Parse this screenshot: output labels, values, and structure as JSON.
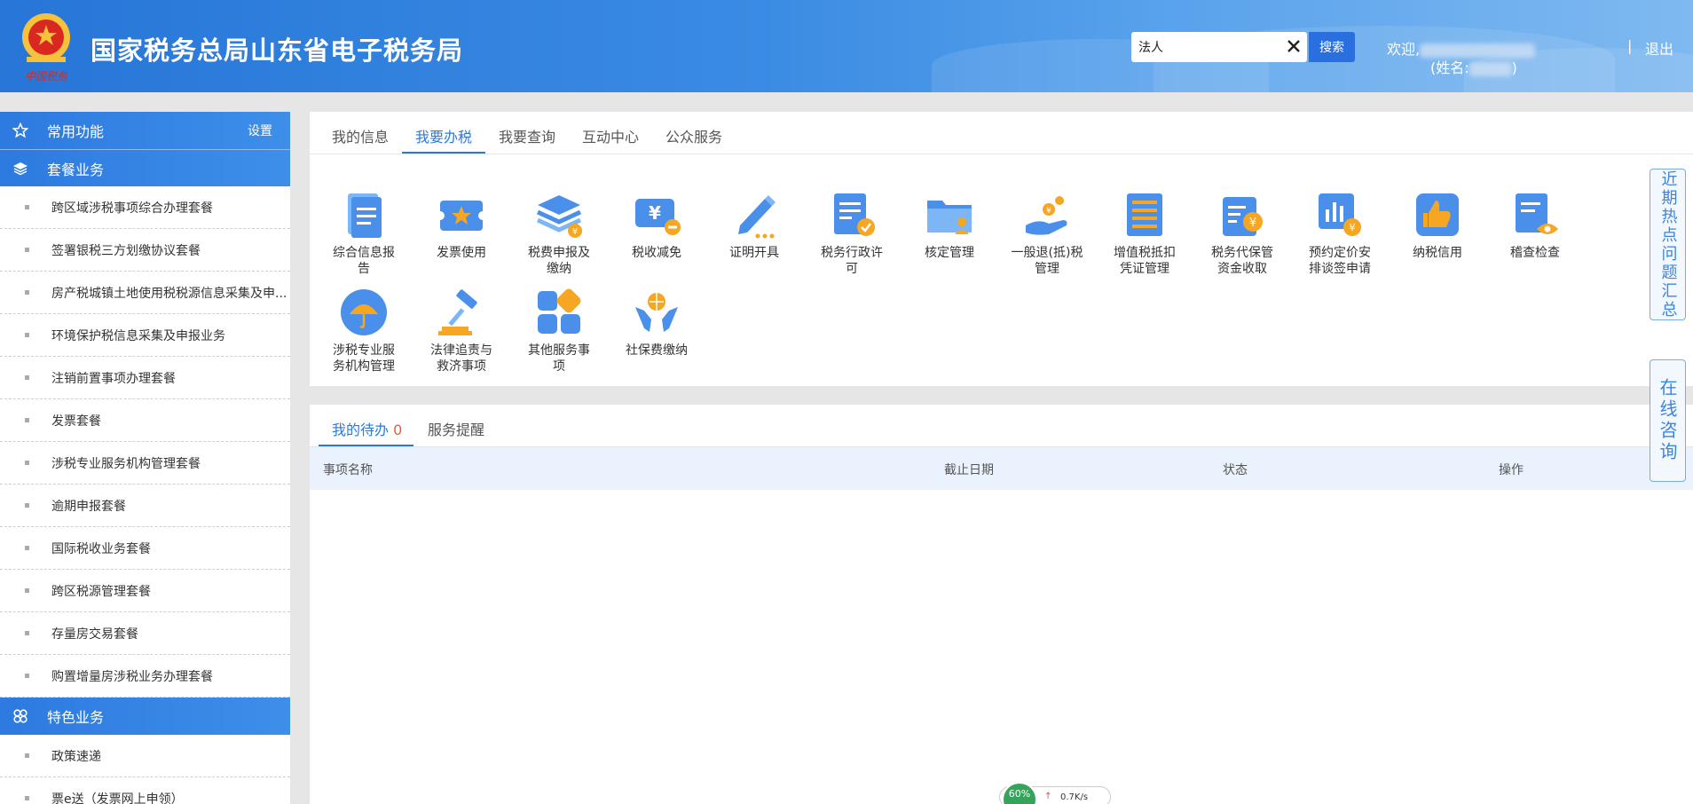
{
  "header": {
    "title": "国家税务总局山东省电子税务局",
    "emblem_text": "中国税务",
    "search": {
      "value": "法人",
      "button_label": "搜索"
    },
    "welcome_prefix": "欢迎,",
    "name_prefix": "(姓名:",
    "name_suffix": ")",
    "separator": "|",
    "logout_label": "退出"
  },
  "sidebar": {
    "common": {
      "label": "常用功能",
      "settings_label": "设置",
      "icon": "star-icon"
    },
    "package": {
      "label": "套餐业务",
      "icon": "layers-icon",
      "items": [
        "跨区域涉税事项综合办理套餐",
        "签署银税三方划缴协议套餐",
        "房产税城镇土地使用税税源信息采集及申...",
        "环境保护税信息采集及申报业务",
        "注销前置事项办理套餐",
        "发票套餐",
        "涉税专业服务机构管理套餐",
        "逾期申报套餐",
        "国际税收业务套餐",
        "跨区税源管理套餐",
        "存量房交易套餐",
        "购置增量房涉税业务办理套餐"
      ]
    },
    "special": {
      "label": "特色业务",
      "icon": "clover-icon",
      "items": [
        "政策速递",
        "票e送（发票网上申领）"
      ]
    }
  },
  "tabs": {
    "items": [
      "我的信息",
      "我要办税",
      "我要查询",
      "互动中心",
      "公众服务"
    ],
    "active": "我要办税"
  },
  "services": [
    {
      "line1": "综合信息报",
      "line2": "告",
      "icon": "document-list-icon"
    },
    {
      "line1": "发票使用",
      "line2": "",
      "icon": "invoice-ticket-icon"
    },
    {
      "line1": "税费申报及",
      "line2": "缴纳",
      "icon": "layers-yuan-icon"
    },
    {
      "line1": "税收减免",
      "line2": "",
      "icon": "tax-reduction-icon"
    },
    {
      "line1": "证明开具",
      "line2": "",
      "icon": "pen-icon"
    },
    {
      "line1": "税务行政许",
      "line2": "可",
      "icon": "permit-document-icon"
    },
    {
      "line1": "核定管理",
      "line2": "",
      "icon": "folder-person-icon"
    },
    {
      "line1": "一般退(抵)税",
      "line2": "管理",
      "icon": "hand-coins-icon"
    },
    {
      "line1": "增值税抵扣",
      "line2": "凭证管理",
      "icon": "vat-voucher-icon"
    },
    {
      "line1": "税务代保管",
      "line2": "资金收取",
      "icon": "custody-funds-icon"
    },
    {
      "line1": "预约定价安",
      "line2": "排谈签申请",
      "icon": "pricing-chart-icon"
    },
    {
      "line1": "纳税信用",
      "line2": "",
      "icon": "thumbs-up-icon"
    },
    {
      "line1": "稽查检查",
      "line2": "",
      "icon": "inspection-eye-icon"
    },
    {
      "line1": "涉税专业服",
      "line2": "务机构管理",
      "icon": "umbrella-icon"
    },
    {
      "line1": "法律追责与",
      "line2": "救济事项",
      "icon": "gavel-icon"
    },
    {
      "line1": "其他服务事",
      "line2": "项",
      "icon": "grid-apps-icon"
    },
    {
      "line1": "社保费缴纳",
      "line2": "",
      "icon": "hands-globe-icon"
    }
  ],
  "todo": {
    "tab_label": "我的待办",
    "count": "0",
    "reminder_label": "服务提醒",
    "columns": [
      "事项名称",
      "截止日期",
      "状态",
      "操作"
    ]
  },
  "float": {
    "hot_topics": "近期热点问题汇总",
    "consult": "在线咨询"
  },
  "netmon": {
    "percent": "60%",
    "speed": "0.7K/s"
  },
  "colors": {
    "primary": "#2b79dc",
    "header": "#3a8be3",
    "count": "#e45b3b"
  }
}
